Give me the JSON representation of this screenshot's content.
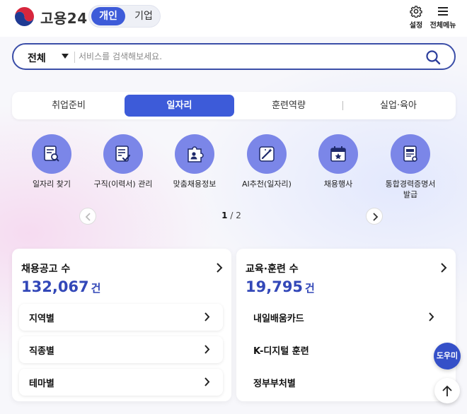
{
  "header": {
    "logo_text": "고용24",
    "segment": {
      "active": "개인",
      "inactive": "기업"
    },
    "settings_label": "설정",
    "menu_label": "전체메뉴"
  },
  "search": {
    "category": "전체",
    "placeholder": "서비스를 검색해보세요."
  },
  "tabs": [
    "취업준비",
    "일자리",
    "훈련역량",
    "실업·육아"
  ],
  "active_tab": "일자리",
  "services": [
    {
      "label": "일자리 찾기",
      "icon": "doc-search-icon"
    },
    {
      "label": "구직(이력서) 관리",
      "icon": "resume-check-icon"
    },
    {
      "label": "맞춤채용정보",
      "icon": "puzzle-person-icon"
    },
    {
      "label": "AI추천(일자리)",
      "icon": "magic-wand-icon"
    },
    {
      "label": "채용행사",
      "icon": "calendar-star-icon"
    },
    {
      "label": "통합경력증명서\n발급",
      "icon": "certificate-icon"
    }
  ],
  "pager": {
    "current": "1",
    "total": "2"
  },
  "cards": {
    "left": {
      "title": "채용공고 수",
      "count": "132,067",
      "unit": "건",
      "rows": [
        "지역별",
        "직종별",
        "테마별"
      ]
    },
    "right": {
      "title": "교육·훈련 수",
      "count": "19,795",
      "unit": "건",
      "rows": [
        "내일배움카드",
        "K-디지털 훈련",
        "정부부처별"
      ]
    }
  },
  "fab": {
    "help": "도우미"
  },
  "colors": {
    "primary": "#3d5bd9",
    "icon_circle": "#7b86e8",
    "count": "#3348b8"
  }
}
